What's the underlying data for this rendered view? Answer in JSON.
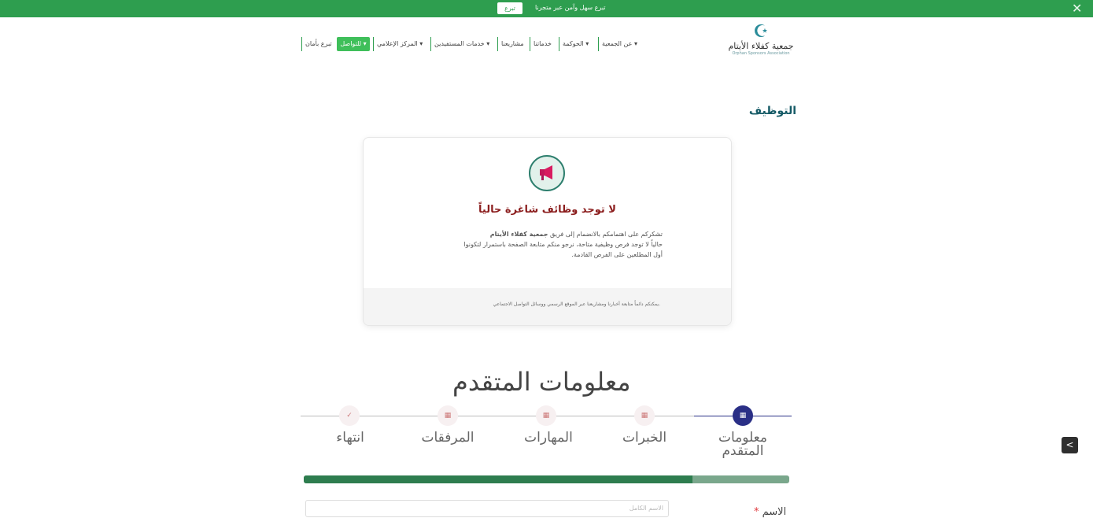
{
  "topbar": {
    "message": "تبرع سهل وآمن عبر متجرنا",
    "button": "تبرع",
    "close_icon": "close-icon"
  },
  "logo": {
    "arabic": "جمعية كفلاء الأيتام",
    "english": "Orphan Sponsors Association"
  },
  "nav": {
    "items": [
      "عن الجمعية ▾",
      "الحوكمة ▾",
      "خدماتنا",
      "مشاريعنا",
      "خدمات المستفيدين ▾",
      "المركز الإعلامي ▾",
      "تبرع بأمان"
    ],
    "cta": "للتواصل ▾"
  },
  "page_title": "التوظيف",
  "card": {
    "icon": "megaphone-icon",
    "heading": "لا توجد وظائف شاغرة حالياً",
    "body_prefix": "تشكركم على اهتمامكم بالانضمام إلى فريق ",
    "org_name": "جمعية كفلاء الأيتام",
    "body_line2": "حالياً لا توجد فرص وظيفية متاحة، نرجو منكم متابعة الصفحة باستمرار لتكونوا",
    "body_line3": "أول المطلعين على الفرص القادمة.",
    "footer": "يمكنكم دائماً متابعة أخبارنا ومشاريعنا عبر الموقع الرسمي ووسائل التواصل الاجتماعي."
  },
  "form": {
    "title": "معلومات المتقدم",
    "steps": [
      "معلومات المتقدم",
      "الخبرات",
      "المهارات",
      "المرفقات",
      "انتهاء"
    ],
    "active_step": 0,
    "progress": 0.8,
    "name_label": "الاسم",
    "required_mark": "*",
    "name_placeholder": "الاسم الكامل"
  },
  "share_icon": "share-icon",
  "colors": {
    "brand_green": "#2e9e4f",
    "accent_navy": "#2a2f86",
    "heading_red": "#8b1d1d"
  }
}
